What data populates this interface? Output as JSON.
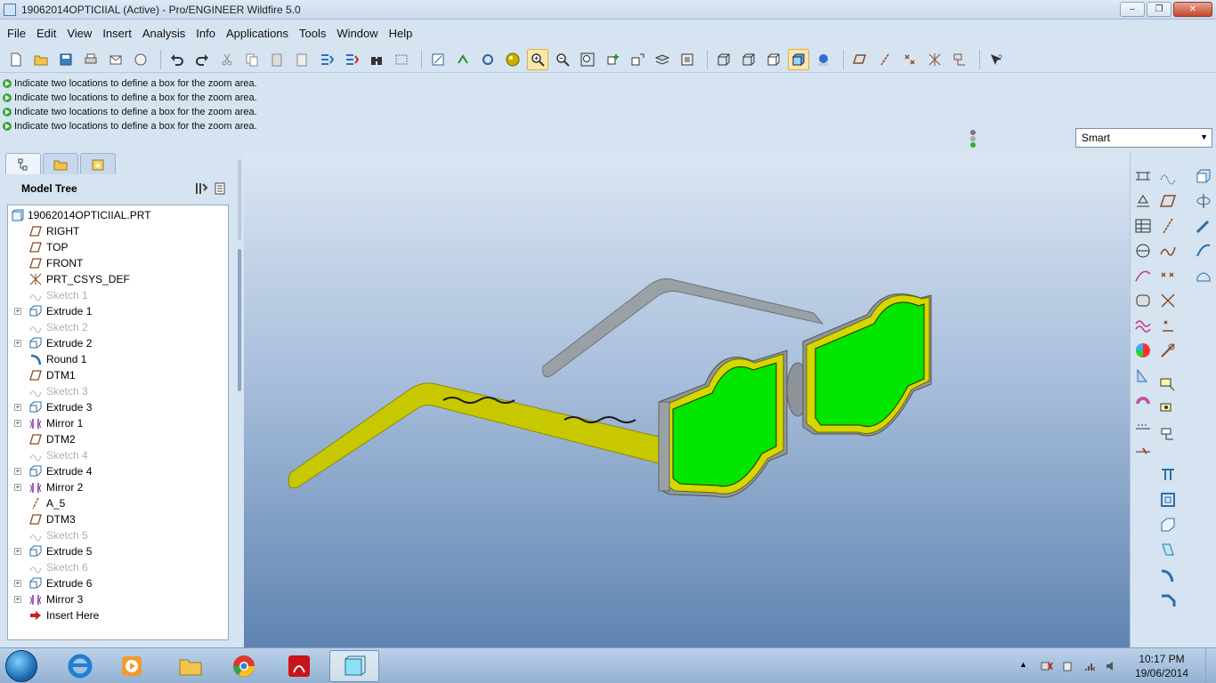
{
  "window": {
    "title": "19062014OPTICIIAL (Active) - Pro/ENGINEER Wildfire 5.0",
    "minimize": "–",
    "maximize": "❐",
    "close": "✕"
  },
  "menu": [
    "File",
    "Edit",
    "View",
    "Insert",
    "Analysis",
    "Info",
    "Applications",
    "Tools",
    "Window",
    "Help"
  ],
  "messages": [
    "Indicate two locations to define a box for the zoom area.",
    "Indicate two locations to define a box for the zoom area.",
    "Indicate two locations to define a box for the zoom area.",
    "Indicate two locations to define a box for the zoom area."
  ],
  "filter": {
    "value": "Smart"
  },
  "model_tree": {
    "header": "Model Tree",
    "root": "19062014OPTICIIAL.PRT",
    "items": [
      {
        "label": "RIGHT",
        "icon": "datum-plane-icon",
        "expandable": false,
        "dim": false
      },
      {
        "label": "TOP",
        "icon": "datum-plane-icon",
        "expandable": false,
        "dim": false
      },
      {
        "label": "FRONT",
        "icon": "datum-plane-icon",
        "expandable": false,
        "dim": false
      },
      {
        "label": "PRT_CSYS_DEF",
        "icon": "csys-icon",
        "expandable": false,
        "dim": false
      },
      {
        "label": "Sketch 1",
        "icon": "sketch-icon",
        "expandable": false,
        "dim": true
      },
      {
        "label": "Extrude 1",
        "icon": "extrude-icon",
        "expandable": true,
        "dim": false
      },
      {
        "label": "Sketch 2",
        "icon": "sketch-icon",
        "expandable": false,
        "dim": true
      },
      {
        "label": "Extrude 2",
        "icon": "extrude-icon",
        "expandable": true,
        "dim": false
      },
      {
        "label": "Round 1",
        "icon": "round-icon",
        "expandable": false,
        "dim": false
      },
      {
        "label": "DTM1",
        "icon": "datum-plane-icon",
        "expandable": false,
        "dim": false
      },
      {
        "label": "Sketch 3",
        "icon": "sketch-icon",
        "expandable": false,
        "dim": true
      },
      {
        "label": "Extrude 3",
        "icon": "extrude-icon",
        "expandable": true,
        "dim": false
      },
      {
        "label": "Mirror 1",
        "icon": "mirror-icon",
        "expandable": true,
        "dim": false
      },
      {
        "label": "DTM2",
        "icon": "datum-plane-icon",
        "expandable": false,
        "dim": false
      },
      {
        "label": "Sketch 4",
        "icon": "sketch-icon",
        "expandable": false,
        "dim": true
      },
      {
        "label": "Extrude 4",
        "icon": "extrude-icon",
        "expandable": true,
        "dim": false
      },
      {
        "label": "Mirror 2",
        "icon": "mirror-icon",
        "expandable": true,
        "dim": false
      },
      {
        "label": "A_5",
        "icon": "axis-icon",
        "expandable": false,
        "dim": false
      },
      {
        "label": "DTM3",
        "icon": "datum-plane-icon",
        "expandable": false,
        "dim": false
      },
      {
        "label": "Sketch 5",
        "icon": "sketch-icon",
        "expandable": false,
        "dim": true
      },
      {
        "label": "Extrude 5",
        "icon": "extrude-icon",
        "expandable": true,
        "dim": false
      },
      {
        "label": "Sketch 6",
        "icon": "sketch-icon",
        "expandable": false,
        "dim": true
      },
      {
        "label": "Extrude 6",
        "icon": "extrude-icon",
        "expandable": true,
        "dim": false
      },
      {
        "label": "Mirror 3",
        "icon": "mirror-icon",
        "expandable": true,
        "dim": false
      },
      {
        "label": "Insert Here",
        "icon": "insert-here-icon",
        "expandable": false,
        "dim": false
      }
    ]
  },
  "colors": {
    "lens": "#00e600",
    "frame": "#d6d600",
    "temple": "#c8c800",
    "metal": "#9aa1a6"
  },
  "taskbar": {
    "time": "10:17 PM",
    "date": "19/06/2014"
  }
}
